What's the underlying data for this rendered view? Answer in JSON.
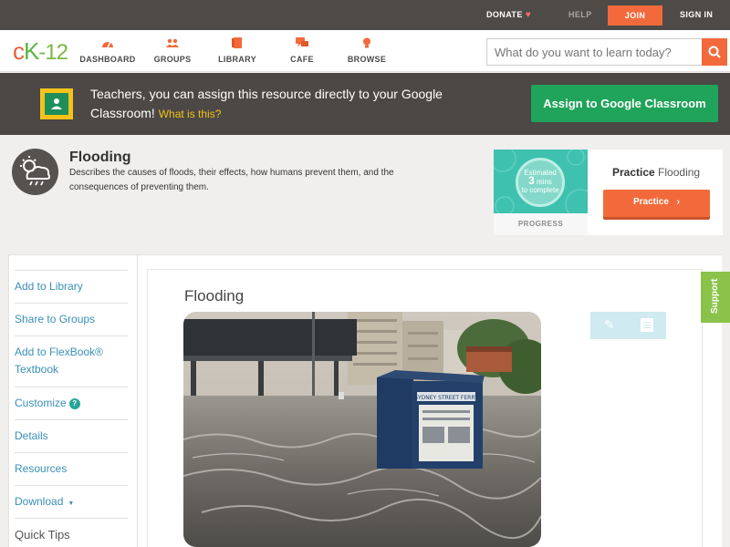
{
  "topbar": {
    "donate": "DONATE",
    "help": "HELP",
    "join": "JOIN",
    "signin": "SIGN IN"
  },
  "nav": {
    "logo": {
      "c": "c",
      "k": "K",
      "n": "-12"
    },
    "items": [
      {
        "label": "DASHBOARD",
        "icon": "dashboard-icon"
      },
      {
        "label": "GROUPS",
        "icon": "groups-icon"
      },
      {
        "label": "LIBRARY",
        "icon": "library-icon"
      },
      {
        "label": "CAFE",
        "icon": "cafe-icon"
      },
      {
        "label": "BROWSE",
        "icon": "browse-icon"
      }
    ],
    "search_placeholder": "What do you want to learn today?"
  },
  "google_classroom": {
    "text": "Teachers, you can assign this resource directly to your Google Classroom!",
    "link": "What is this?",
    "button": "Assign to Google Classroom"
  },
  "concept": {
    "title": "Flooding",
    "description": "Describes the causes of floods, their effects, how humans prevent them, and the consequences of preventing them."
  },
  "practice": {
    "estimated": "Estimated",
    "mins": "3",
    "mins_label": "mins",
    "to_complete": "to complete",
    "progress_label": "PROGRESS",
    "title_prefix": "Practice",
    "title_topic": "Flooding",
    "button": "Practice"
  },
  "sidebar": {
    "items": [
      {
        "label": "Add to Library"
      },
      {
        "label": "Share to Groups"
      },
      {
        "label": "Add to FlexBook® Textbook"
      },
      {
        "label": "Customize",
        "help": "?"
      },
      {
        "label": "Details"
      },
      {
        "label": "Resources"
      },
      {
        "label": "Download",
        "caret": "▼"
      },
      {
        "label": "Quick Tips"
      }
    ]
  },
  "content": {
    "title": "Flooding",
    "photo_sign_text": "SYDNEY STREET FERRY"
  },
  "support": "Support",
  "colors": {
    "accent": "#f26a3c",
    "green": "#20a35a",
    "teal": "#3fc1b0",
    "link": "#3a8fb7"
  }
}
